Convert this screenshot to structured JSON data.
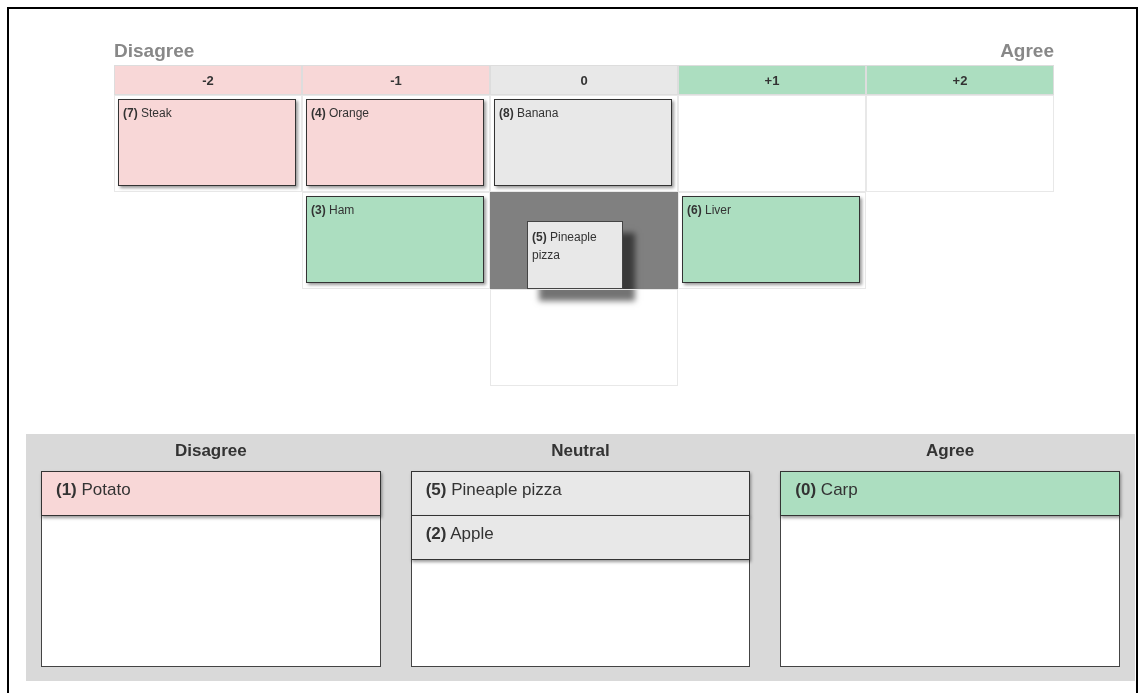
{
  "scale": {
    "left_label": "Disagree",
    "right_label": "Agree"
  },
  "grid": {
    "columns": [
      {
        "label": "-2",
        "color": "#f8d7d7",
        "slots": [
          {
            "kind": "card",
            "text": "**(7)** Steak",
            "color": "#f8d7d7"
          }
        ]
      },
      {
        "label": "-1",
        "color": "#f8d7d7",
        "slots": [
          {
            "kind": "card",
            "text": "**(4)** Orange",
            "color": "#f8d7d7"
          },
          {
            "kind": "card",
            "text": "**(3)** Ham",
            "color": "#acdec0"
          }
        ]
      },
      {
        "label": "0",
        "color": "#e8e8e8",
        "slots": [
          {
            "kind": "card",
            "text": "**(8)** Banana",
            "color": "#e8e8e8"
          },
          {
            "kind": "placeholder",
            "dragged": {
              "text": "**(5)** Pineaple pizza",
              "color": "#e8e8e8"
            }
          },
          {
            "kind": "empty"
          }
        ]
      },
      {
        "label": "+1",
        "color": "#acdec0",
        "slots": [
          {
            "kind": "empty"
          },
          {
            "kind": "card",
            "text": "**(6)** Liver",
            "color": "#acdec0"
          }
        ]
      },
      {
        "label": "+2",
        "color": "#acdec0",
        "slots": [
          {
            "kind": "empty"
          }
        ]
      }
    ]
  },
  "bins": [
    {
      "title": "Disagree",
      "cards": [
        {
          "text": "**(1)** Potato",
          "color": "#f8d7d7"
        }
      ]
    },
    {
      "title": "Neutral",
      "cards": [
        {
          "text": "**(5)** Pineaple pizza",
          "color": "#e8e8e8"
        },
        {
          "text": "**(2)** Apple",
          "color": "#e8e8e8"
        }
      ]
    },
    {
      "title": "Agree",
      "cards": [
        {
          "text": "**(0)** Carp",
          "color": "#acdec0"
        }
      ]
    }
  ]
}
